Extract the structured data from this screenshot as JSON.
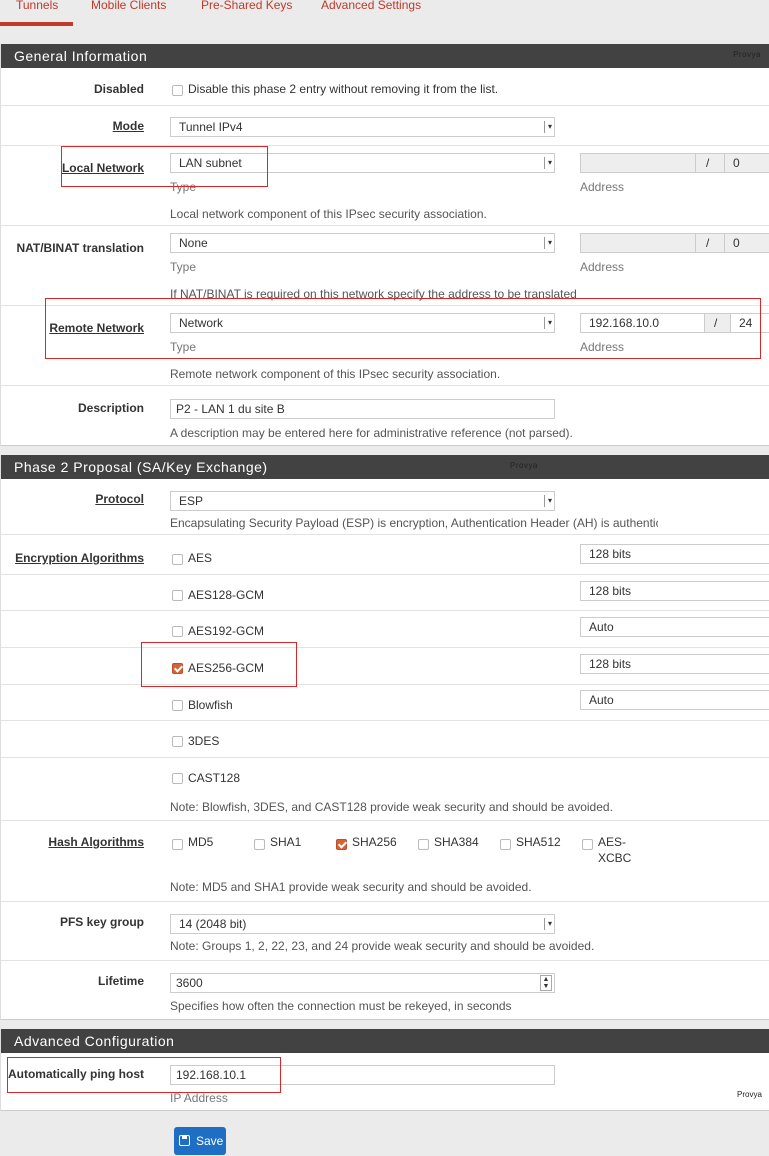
{
  "tabs": [
    "Tunnels",
    "Mobile Clients",
    "Pre-Shared Keys",
    "Advanced Settings"
  ],
  "watermark": "Provya",
  "general": {
    "title": "General Information",
    "disabled": {
      "label": "Disabled",
      "text": "Disable this phase 2 entry without removing it from the list."
    },
    "mode": {
      "label": "Mode",
      "value": "Tunnel IPv4"
    },
    "local": {
      "label": "Local Network",
      "type_value": "LAN subnet",
      "type_label": "Type",
      "address_label": "Address",
      "address": "",
      "mask": "0",
      "slash": "/",
      "help": "Local network component of this IPsec security association."
    },
    "nat": {
      "label": "NAT/BINAT translation",
      "type_value": "None",
      "type_label": "Type",
      "address_label": "Address",
      "address": "",
      "mask": "0",
      "slash": "/",
      "help": "If NAT/BINAT is required on this network specify the address to be translated"
    },
    "remote": {
      "label": "Remote Network",
      "type_value": "Network",
      "type_label": "Type",
      "address_label": "Address",
      "address": "192.168.10.0",
      "mask": "24",
      "slash": "/",
      "help": "Remote network component of this IPsec security association."
    },
    "description": {
      "label": "Description",
      "value": "P2 - LAN 1 du site B",
      "help": "A description may be entered here for administrative reference (not parsed)."
    }
  },
  "phase2": {
    "title": "Phase 2 Proposal (SA/Key Exchange)",
    "protocol": {
      "label": "Protocol",
      "value": "ESP",
      "help": "Encapsulating Security Payload (ESP) is encryption, Authentication Header (AH) is authentica"
    },
    "enc_label": "Encryption Algorithms",
    "algorithms": [
      {
        "name": "AES",
        "checked": false,
        "key": "128 bits"
      },
      {
        "name": "AES128-GCM",
        "checked": false,
        "key": "128 bits"
      },
      {
        "name": "AES192-GCM",
        "checked": false,
        "key": "Auto"
      },
      {
        "name": "AES256-GCM",
        "checked": true,
        "key": "128 bits"
      },
      {
        "name": "Blowfish",
        "checked": false,
        "key": "Auto"
      },
      {
        "name": "3DES",
        "checked": false,
        "key": ""
      },
      {
        "name": "CAST128",
        "checked": false,
        "key": ""
      }
    ],
    "enc_note": "Note: Blowfish, 3DES, and CAST128 provide weak security and should be avoided.",
    "hash": {
      "label": "Hash Algorithms",
      "items": [
        {
          "name": "MD5",
          "checked": false
        },
        {
          "name": "SHA1",
          "checked": false
        },
        {
          "name": "SHA256",
          "checked": true
        },
        {
          "name": "SHA384",
          "checked": false
        },
        {
          "name": "SHA512",
          "checked": false
        },
        {
          "name": "AES-",
          "name2": "XCBC",
          "checked": false
        }
      ],
      "note": "Note: MD5 and SHA1 provide weak security and should be avoided."
    },
    "pfs": {
      "label": "PFS key group",
      "value": "14 (2048 bit)",
      "note": "Note: Groups 1, 2, 22, 23, and 24 provide weak security and should be avoided."
    },
    "lifetime": {
      "label": "Lifetime",
      "value": "3600",
      "help": "Specifies how often the connection must be rekeyed, in seconds"
    }
  },
  "advanced": {
    "title": "Advanced Configuration",
    "ping": {
      "label": "Automatically ping host",
      "value": "192.168.10.1",
      "sub": "IP Address"
    }
  },
  "save_label": "Save"
}
